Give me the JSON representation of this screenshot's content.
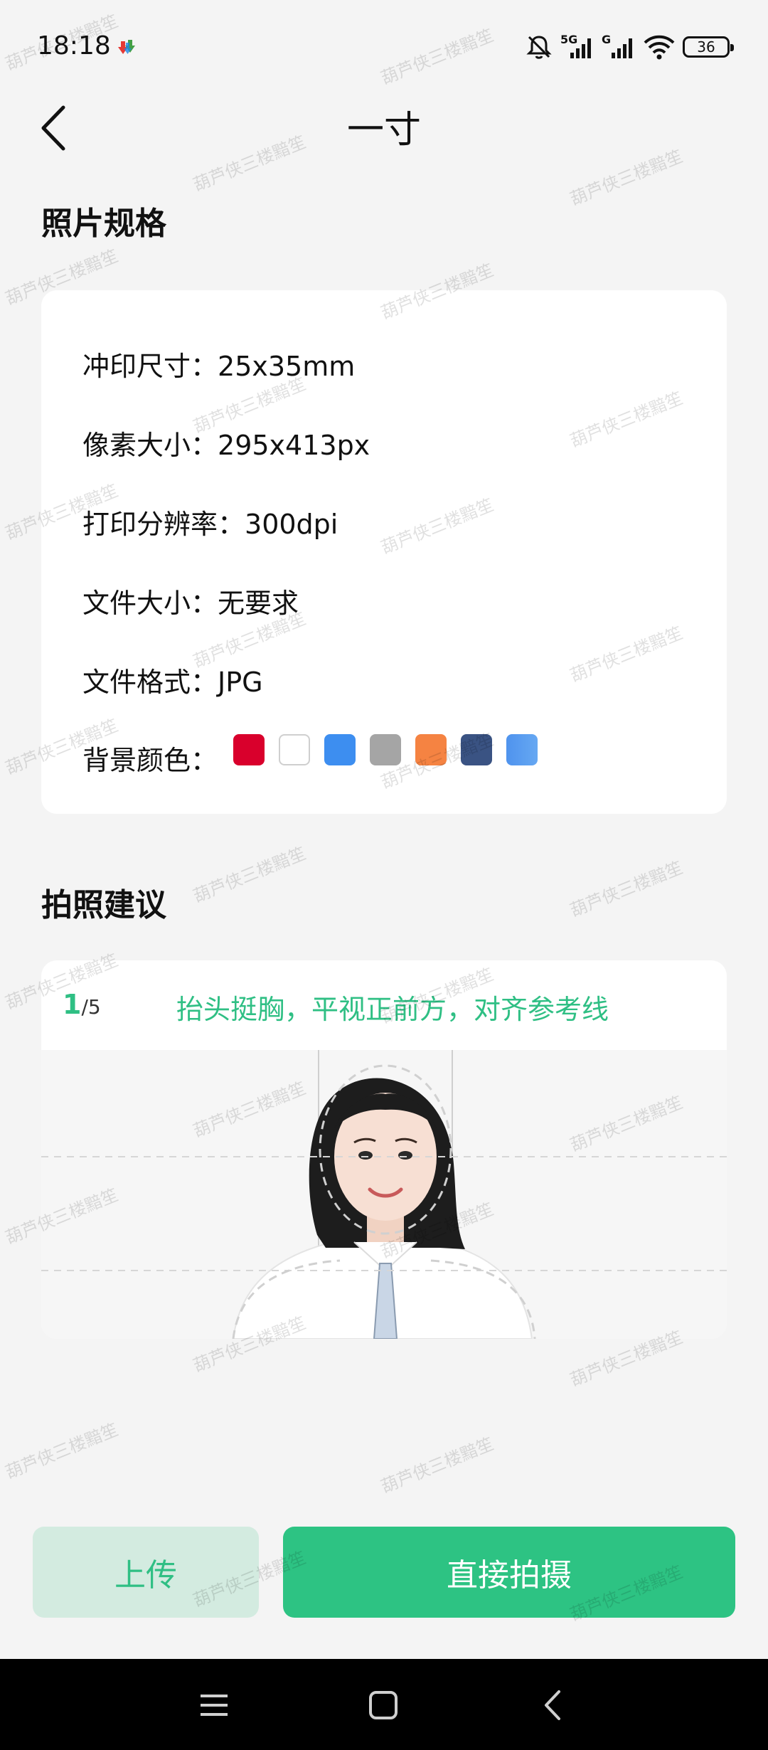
{
  "status_bar": {
    "time": "18:18",
    "battery": "36",
    "network_5g": "5G",
    "network_g": "G"
  },
  "header": {
    "title": "一寸"
  },
  "spec_section": {
    "title": "照片规格",
    "rows": [
      {
        "label": "冲印尺寸：",
        "value": "25x35mm"
      },
      {
        "label": "像素大小：",
        "value": "295x413px"
      },
      {
        "label": "打印分辨率：",
        "value": "300dpi"
      },
      {
        "label": "文件大小：",
        "value": "无要求"
      },
      {
        "label": "文件格式：",
        "value": "JPG"
      }
    ],
    "background_label": "背景颜色：",
    "background_colors": [
      "#d9002c",
      "#ffffff",
      "#3d8ef0",
      "#a5a5a5",
      "#f58342",
      "#3a5383",
      "#66a8f2"
    ]
  },
  "tips_section": {
    "title": "拍照建议",
    "counter_current": "1",
    "counter_total": "/5",
    "tip_text": "抬头挺胸，平视正前方，对齐参考线"
  },
  "actions": {
    "upload_label": "上传",
    "shoot_label": "直接拍摄"
  },
  "watermark_text": "葫芦侠三楼黯笙",
  "colors": {
    "accent": "#2dc383",
    "accent_light": "#d3ebe0",
    "background": "#f4f4f4"
  }
}
